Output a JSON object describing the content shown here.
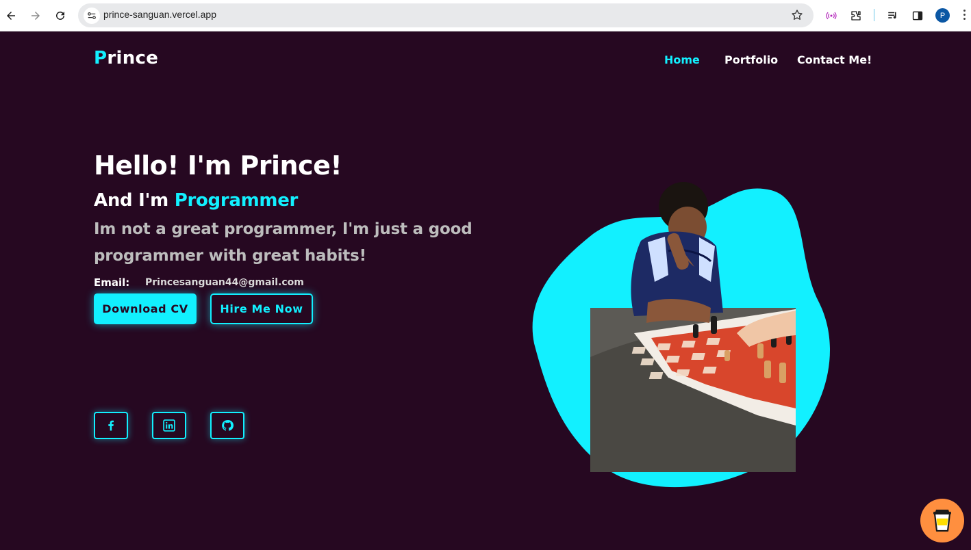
{
  "browser": {
    "url": "prince-sanguan.vercel.app",
    "profile_initial": "P",
    "icons": [
      "back-icon",
      "forward-icon",
      "reload-icon",
      "site-info-icon",
      "bookmark-star-icon",
      "cast-icon",
      "extensions-icon",
      "media-icon",
      "side-panel-icon",
      "menu-icon"
    ]
  },
  "site": {
    "logo_first": "P",
    "logo_rest": "rince",
    "nav": [
      {
        "label": "Home",
        "active": true
      },
      {
        "label": "Portfolio",
        "active": false
      },
      {
        "label": "Contact Me!",
        "active": false
      }
    ]
  },
  "hero": {
    "greeting": "Hello! I'm Prince!",
    "and_im": "And I'm",
    "role": "Programmer",
    "quote": "Im not a great programmer, I'm just a good programmer with great habits!",
    "email_label": "Email:",
    "email_value": "Princesanguan44@gmail.com",
    "download_cv": "Download CV",
    "hire_me": "Hire Me Now"
  },
  "social": [
    "facebook-icon",
    "linkedin-icon",
    "github-icon"
  ],
  "colors": {
    "background": "#260821",
    "accent": "#12f0ff",
    "coffee_button": "#ff8f3f"
  }
}
